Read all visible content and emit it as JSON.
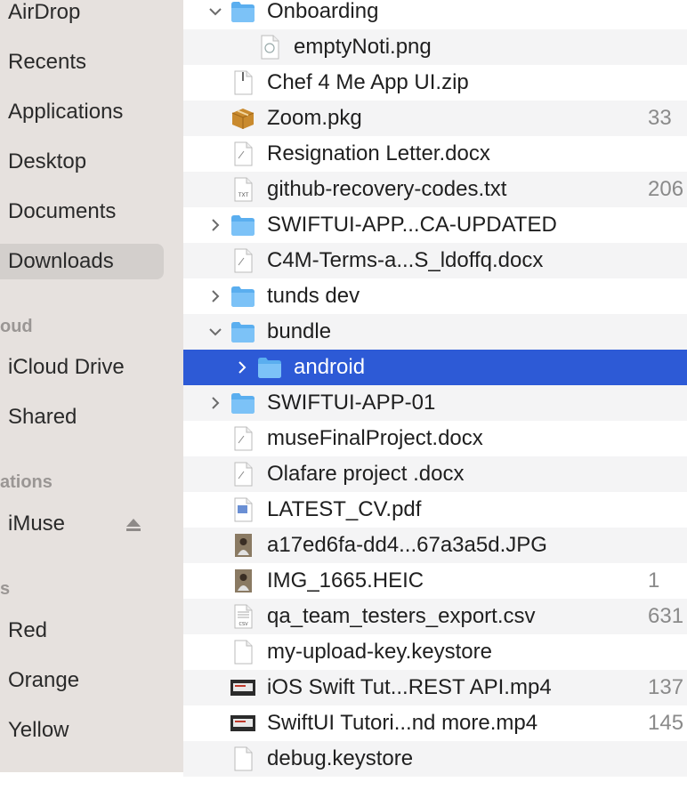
{
  "sidebar": {
    "items": [
      {
        "label": "AirDrop"
      },
      {
        "label": "Recents"
      },
      {
        "label": "Applications"
      },
      {
        "label": "Desktop"
      },
      {
        "label": "Documents"
      },
      {
        "label": "Downloads",
        "selected": true
      }
    ],
    "icloud_header": "oud",
    "icloud_items": [
      {
        "label": "iCloud Drive"
      },
      {
        "label": "Shared"
      }
    ],
    "locations_header": "ations",
    "locations_items": [
      {
        "label": "iMuse"
      }
    ],
    "tags_header": "s",
    "tags": [
      {
        "label": "Red"
      },
      {
        "label": "Orange"
      },
      {
        "label": "Yellow"
      }
    ]
  },
  "files": [
    {
      "name": "Onboarding",
      "size": "",
      "icon": "folder-icon",
      "chevron": "down",
      "indent": 0
    },
    {
      "name": "emptyNoti.png",
      "size": "",
      "icon": "image-file-icon",
      "chevron": "",
      "indent": 1
    },
    {
      "name": "Chef 4 Me App UI.zip",
      "size": "",
      "icon": "zip-file-icon",
      "chevron": "",
      "indent": 0
    },
    {
      "name": "Zoom.pkg",
      "size": "33",
      "icon": "package-icon",
      "chevron": "",
      "indent": 0
    },
    {
      "name": "Resignation Letter.docx",
      "size": "",
      "icon": "document-icon",
      "chevron": "",
      "indent": 0
    },
    {
      "name": "github-recovery-codes.txt",
      "size": "206",
      "icon": "text-file-icon",
      "chevron": "",
      "indent": 0
    },
    {
      "name": "SWIFTUI-APP...CA-UPDATED",
      "size": "",
      "icon": "folder-icon",
      "chevron": "right",
      "indent": 0
    },
    {
      "name": "C4M-Terms-a...S_ldoffq.docx",
      "size": "",
      "icon": "document-icon",
      "chevron": "",
      "indent": 0
    },
    {
      "name": "tunds dev",
      "size": "",
      "icon": "folder-icon",
      "chevron": "right",
      "indent": 0
    },
    {
      "name": "bundle",
      "size": "",
      "icon": "folder-icon",
      "chevron": "down",
      "indent": 0
    },
    {
      "name": "android",
      "size": "",
      "icon": "folder-icon",
      "chevron": "right",
      "indent": 1,
      "selected": true
    },
    {
      "name": "SWIFTUI-APP-01",
      "size": "",
      "icon": "folder-icon",
      "chevron": "right",
      "indent": 0
    },
    {
      "name": "museFinalProject.docx",
      "size": "",
      "icon": "document-icon",
      "chevron": "",
      "indent": 0
    },
    {
      "name": "Olafare project .docx",
      "size": "",
      "icon": "document-icon",
      "chevron": "",
      "indent": 0
    },
    {
      "name": "LATEST_CV.pdf",
      "size": "",
      "icon": "pdf-file-icon",
      "chevron": "",
      "indent": 0
    },
    {
      "name": "a17ed6fa-dd4...67a3a5d.JPG",
      "size": "",
      "icon": "photo-thumbnail-icon",
      "chevron": "",
      "indent": 0
    },
    {
      "name": "IMG_1665.HEIC",
      "size": "1",
      "icon": "photo-thumbnail-icon",
      "chevron": "",
      "indent": 0
    },
    {
      "name": "qa_team_testers_export.csv",
      "size": "631",
      "icon": "csv-file-icon",
      "chevron": "",
      "indent": 0
    },
    {
      "name": "my-upload-key.keystore",
      "size": "",
      "icon": "blank-file-icon",
      "chevron": "",
      "indent": 0
    },
    {
      "name": "iOS Swift Tut...REST API.mp4",
      "size": "137",
      "icon": "video-thumbnail-icon",
      "chevron": "",
      "indent": 0
    },
    {
      "name": "SwiftUI Tutori...nd more.mp4",
      "size": "145",
      "icon": "video-thumbnail-icon",
      "chevron": "",
      "indent": 0
    },
    {
      "name": "debug.keystore",
      "size": "",
      "icon": "blank-file-icon",
      "chevron": "",
      "indent": 0
    }
  ],
  "colors": {
    "selection": "#2d5ad6",
    "folder": "#69b6f2",
    "sidebar": "#e6e1de"
  }
}
